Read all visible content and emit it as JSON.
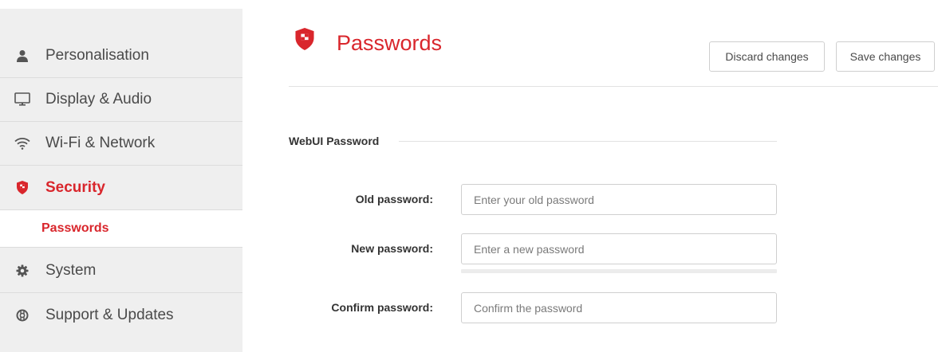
{
  "sidebar": {
    "items": [
      {
        "label": "Personalisation",
        "icon": "user-icon"
      },
      {
        "label": "Display & Audio",
        "icon": "monitor-icon"
      },
      {
        "label": "Wi-Fi & Network",
        "icon": "wifi-icon"
      },
      {
        "label": "Security",
        "icon": "shield-icon",
        "active": true
      },
      {
        "label": "System",
        "icon": "gear-icon"
      },
      {
        "label": "Support & Updates",
        "icon": "lifebuoy-icon"
      }
    ],
    "subitems": [
      {
        "label": "Passwords",
        "active": true
      }
    ]
  },
  "header": {
    "title": "Passwords",
    "icon": "shield-icon",
    "discard_label": "Discard changes",
    "save_label": "Save changes"
  },
  "section": {
    "title": "WebUI Password"
  },
  "form": {
    "old_password": {
      "label": "Old password:",
      "placeholder": "Enter your old password",
      "value": ""
    },
    "new_password": {
      "label": "New password:",
      "placeholder": "Enter a new password",
      "value": ""
    },
    "confirm_password": {
      "label": "Confirm password:",
      "placeholder": "Confirm the password",
      "value": ""
    },
    "strength": 0
  },
  "colors": {
    "accent": "#d9262c",
    "sidebar_bg": "#efefef",
    "text": "#4a4a4a"
  }
}
